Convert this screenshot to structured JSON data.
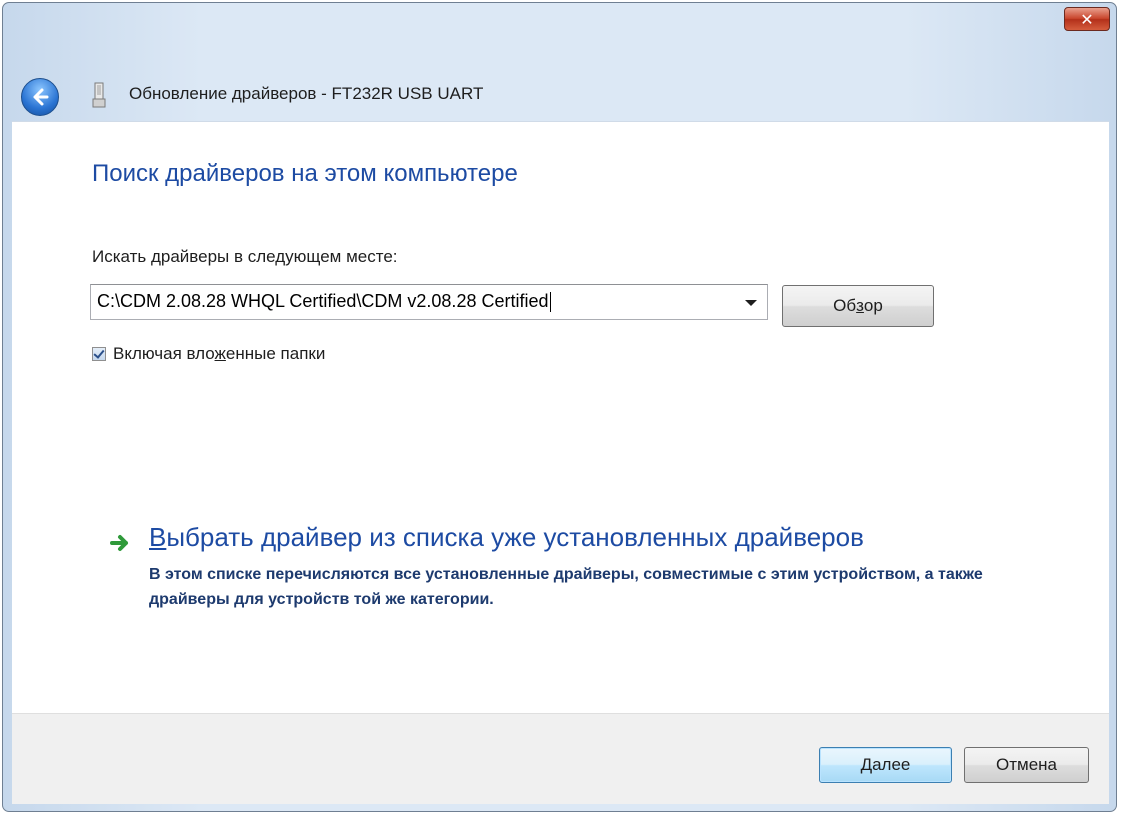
{
  "window": {
    "title": "Обновление драйверов - FT232R USB UART",
    "close_symbol": "✕"
  },
  "page": {
    "heading": "Поиск драйверов на этом компьютере",
    "search_label": "Искать драйверы в следующем месте:",
    "path_value": "C:\\CDM 2.08.28 WHQL Certified\\CDM v2.08.28 Certified",
    "browse": {
      "pre": "Об",
      "accel": "з",
      "post": "ор"
    },
    "include_subfolders": {
      "pre": "Включая вло",
      "accel": "ж",
      "post": "енные папки",
      "checked": true
    }
  },
  "pick_from_list": {
    "title_accel": "В",
    "title_rest": "ыбрать драйвер из списка уже установленных драйверов",
    "description": "В этом списке перечисляются все установленные драйверы, совместимые с этим устройством, а также драйверы для устройств той же категории."
  },
  "footer": {
    "next_label": "Далее",
    "cancel_label": "Отмена"
  },
  "icons": [
    "back-arrow-icon",
    "usb-device-icon",
    "green-arrow-icon",
    "close-icon",
    "dropdown-arrow-icon",
    "checkbox-checked-icon"
  ],
  "colors": {
    "link_blue": "#1d4ba3",
    "close_red": "#c9452c"
  }
}
